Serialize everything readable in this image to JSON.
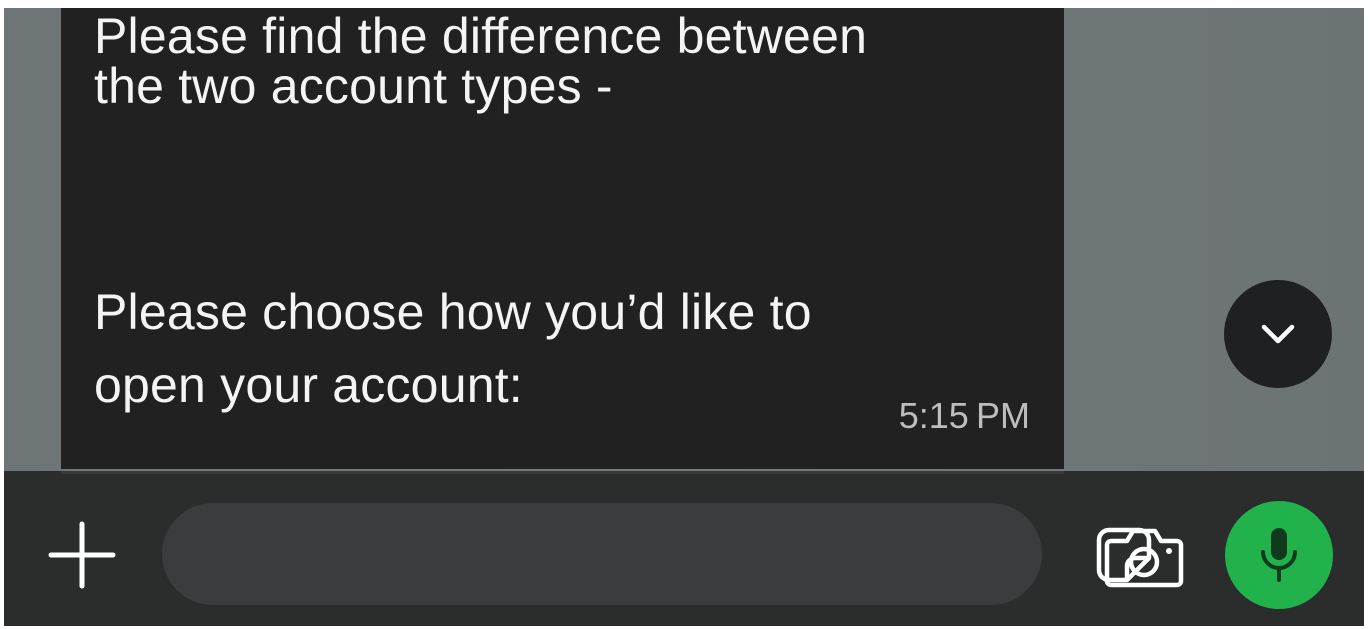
{
  "chat": {
    "message": {
      "lines": [
        "Please find the difference between",
        "the two account types -",
        "Please choose how you’d like to",
        "open your account:"
      ],
      "time": "5:15 PM"
    }
  },
  "composer": {
    "input_value": "",
    "input_placeholder": ""
  },
  "icons": {
    "scroll_down": "chevron-down-icon",
    "add": "plus-icon",
    "sticker": "sticker-icon",
    "camera": "camera-icon",
    "mic": "microphone-icon"
  },
  "colors": {
    "bubble": "#212121",
    "chat_background": "#6f7677",
    "composer_background": "#2b2d2d",
    "input_background": "#3a3d3d",
    "mic_button": "#22b24c",
    "message_text": "#f4f4f4",
    "timestamp": "#bdbdbd"
  }
}
